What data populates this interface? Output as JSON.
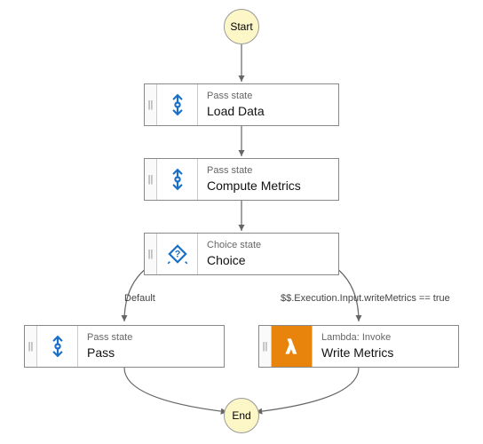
{
  "terminals": {
    "start": "Start",
    "end": "End"
  },
  "nodes": {
    "loadData": {
      "type": "Pass state",
      "name": "Load Data"
    },
    "computeMetrics": {
      "type": "Pass state",
      "name": "Compute Metrics"
    },
    "choice": {
      "type": "Choice state",
      "name": "Choice"
    },
    "pass": {
      "type": "Pass state",
      "name": "Pass"
    },
    "writeMetrics": {
      "type": "Lambda: Invoke",
      "name": "Write Metrics"
    }
  },
  "edges": {
    "default": "Default",
    "condition": "$$.Execution.Input.writeMetrics == true"
  }
}
